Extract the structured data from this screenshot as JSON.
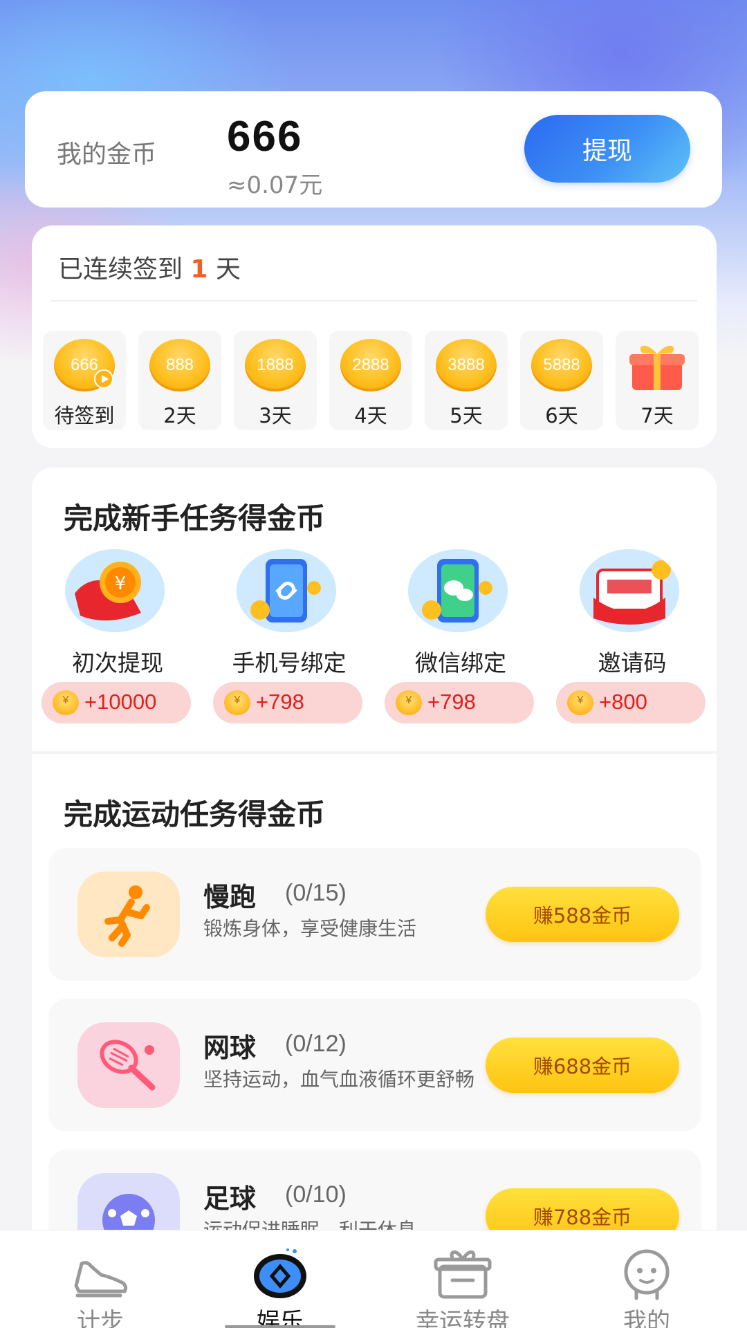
{
  "balance": {
    "label": "我的金币",
    "amount": "666",
    "approx": "≈0.07元",
    "withdraw_label": "提现"
  },
  "signin": {
    "prefix": "已连续签到",
    "streak": "1",
    "suffix": "天",
    "days": [
      {
        "coin": "666",
        "label": "待签到",
        "type": "coin-play"
      },
      {
        "coin": "888",
        "label": "2天",
        "type": "coin"
      },
      {
        "coin": "1888",
        "label": "3天",
        "type": "coin"
      },
      {
        "coin": "2888",
        "label": "4天",
        "type": "coin"
      },
      {
        "coin": "3888",
        "label": "5天",
        "type": "coin"
      },
      {
        "coin": "5888",
        "label": "6天",
        "type": "coin"
      },
      {
        "coin": "",
        "label": "7天",
        "type": "gift"
      }
    ]
  },
  "newbie": {
    "title": "完成新手任务得金币",
    "items": [
      {
        "label": "初次提现",
        "reward": "+10000",
        "icon": "red-envelope-coin-icon"
      },
      {
        "label": "手机号绑定",
        "reward": "+798",
        "icon": "phone-link-icon"
      },
      {
        "label": "微信绑定",
        "reward": "+798",
        "icon": "wechat-phone-icon"
      },
      {
        "label": "邀请码",
        "reward": "+800",
        "icon": "invite-ticket-icon"
      }
    ]
  },
  "sport": {
    "title": "完成运动任务得金币",
    "items": [
      {
        "name": "慢跑",
        "progress": "(0/15)",
        "desc": "锻炼身体，享受健康生活",
        "button": "赚588金币",
        "icon": "running-icon",
        "icon_bg": "#ffe7c4"
      },
      {
        "name": "网球",
        "progress": "(0/12)",
        "desc": "坚持运动，血气血液循环更舒畅",
        "button": "赚688金币",
        "icon": "tennis-icon",
        "icon_bg": "#fbd3df"
      },
      {
        "name": "足球",
        "progress": "(0/10)",
        "desc": "运动促进睡眠，利于休息",
        "button": "赚788金币",
        "icon": "soccer-icon",
        "icon_bg": "#dcdcfb"
      }
    ]
  },
  "nav": {
    "items": [
      {
        "label": "计步",
        "icon": "sneaker-icon",
        "active": false
      },
      {
        "label": "娱乐",
        "icon": "entertainment-icon",
        "active": true
      },
      {
        "label": "幸运转盘",
        "icon": "gift-box-icon",
        "active": false
      },
      {
        "label": "我的",
        "icon": "profile-icon",
        "active": false
      }
    ]
  },
  "colors": {
    "accent_blue": "#2b6af0",
    "streak_orange": "#f06022",
    "reward_red": "#e0201c",
    "earn_button_yellow": "#ffc412"
  }
}
